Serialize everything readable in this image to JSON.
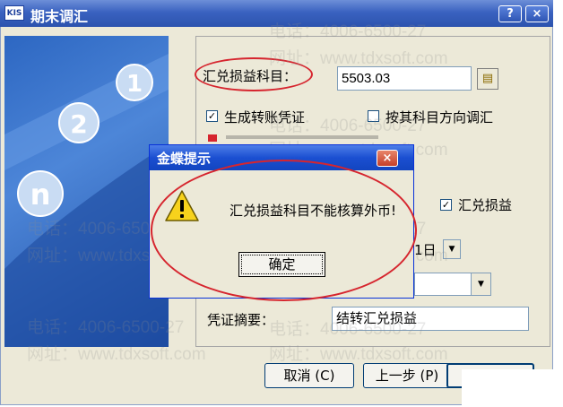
{
  "main_window": {
    "title": "期末调汇",
    "app_icon_text": "KIS",
    "help_label": "?",
    "close_label": "×"
  },
  "form": {
    "account_label": "汇兑损益科目：",
    "account_value": "5503.03",
    "generate_voucher_label": "生成转账凭证",
    "generate_voucher_checked": true,
    "direction_label": "按其科目方向调汇",
    "direction_checked": false,
    "fx_gain_loss_label": "汇兑损益",
    "fx_gain_loss_checked": true,
    "date_day": "1日",
    "summary_label": "凭证摘要：",
    "summary_value": "结转汇兑损益"
  },
  "buttons": {
    "cancel": "取消 (C)",
    "prev": "上一步 (P)"
  },
  "messagebox": {
    "title": "金蝶提示",
    "text": "汇兑损益科目不能核算外币!",
    "ok": "确定",
    "close_label": "×"
  },
  "art_panel": {
    "numbers": [
      "1",
      "2",
      "n"
    ]
  },
  "watermark": {
    "phone": "电话：4006-6500-27",
    "site": "网址：www.tdxsoft.com"
  },
  "colors": {
    "titlebar": "#2c53ae",
    "highlight": "#d6252e",
    "dialog_bg": "#ece9d8"
  }
}
